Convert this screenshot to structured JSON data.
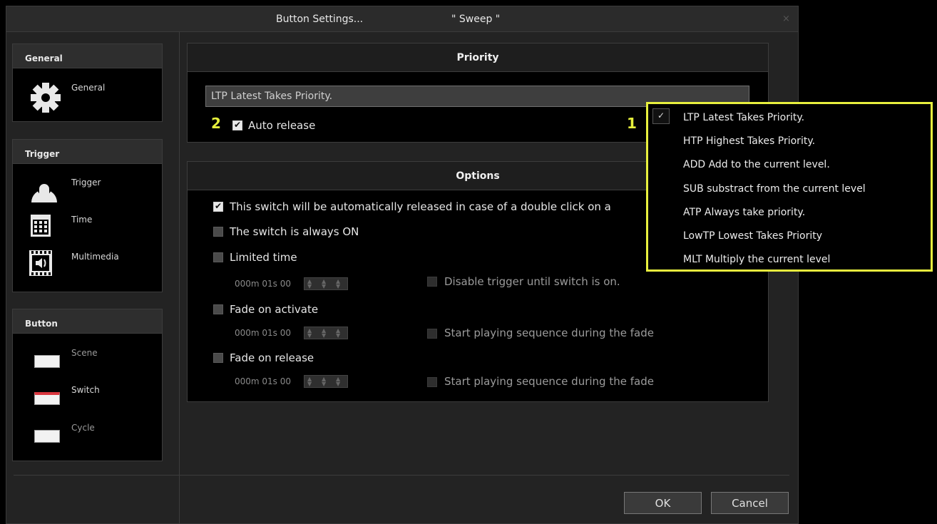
{
  "window": {
    "title": "Button  Settings...",
    "subtitle": "\" Sweep \"",
    "close_glyph": "×"
  },
  "sidebar": {
    "general": {
      "heading": "General",
      "items": [
        {
          "label": "General",
          "icon": "gear-icon"
        }
      ]
    },
    "trigger": {
      "heading": "Trigger",
      "items": [
        {
          "label": "Trigger",
          "icon": "touch-icon"
        },
        {
          "label": "Time",
          "icon": "calendar-icon"
        },
        {
          "label": "Multimedia",
          "icon": "film-icon"
        }
      ]
    },
    "button": {
      "heading": "Button",
      "items": [
        {
          "label": "Scene",
          "icon": "scene-button-icon"
        },
        {
          "label": "Switch",
          "icon": "switch-button-icon"
        },
        {
          "label": "Cycle",
          "icon": "cycle-button-icon"
        }
      ]
    }
  },
  "priority": {
    "heading": "Priority",
    "selected": "LTP   Latest Takes Priority.",
    "auto_release": {
      "label": "Auto release",
      "checked": true
    }
  },
  "options": {
    "heading": "Options",
    "double_click": {
      "label": "This switch will be automatically released in case of a double click on a",
      "checked": true
    },
    "always_on": {
      "label": "The switch is always ON",
      "checked": false
    },
    "limited_time": {
      "label": "Limited time",
      "checked": false,
      "time": "000m 01s 00"
    },
    "disable_trigger": {
      "label": "Disable trigger until switch is on.",
      "checked": false
    },
    "fade_activate": {
      "label": "Fade on activate",
      "checked": false,
      "time": "000m 01s 00"
    },
    "start_seq_1": {
      "label": "Start playing sequence during the fade",
      "checked": false
    },
    "fade_release": {
      "label": "Fade on release",
      "checked": false,
      "time": "000m 01s 00"
    },
    "start_seq_2": {
      "label": "Start playing sequence during the fade",
      "checked": false
    }
  },
  "dropdown": {
    "items": [
      "LTP   Latest Takes Priority.",
      "HTP   Highest Takes Priority.",
      "ADD   Add to the current level.",
      "SUB substract from the current level",
      "ATP Always take priority.",
      "LowTP Lowest Takes Priority",
      "MLT Multiply the current level"
    ],
    "check_glyph": "✓"
  },
  "markers": {
    "one": "1",
    "two": "2"
  },
  "buttons": {
    "ok": "OK",
    "cancel": "Cancel"
  },
  "colors": {
    "highlight": "#e8f03e",
    "background": "#232323"
  }
}
